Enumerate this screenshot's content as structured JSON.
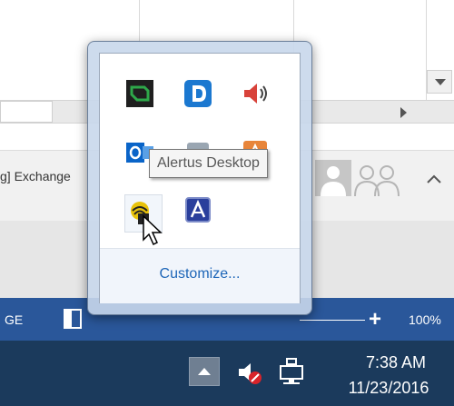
{
  "document": {
    "exchange_label": "g] Exchange"
  },
  "status_bar": {
    "left_text": "GE",
    "zoom_level": "100%",
    "zoom_plus": "+"
  },
  "overflow_popup": {
    "icons": [
      {
        "name": "green-app-icon",
        "color": "#2ea84a"
      },
      {
        "name": "d-app-icon",
        "color": "#1b78d0"
      },
      {
        "name": "volume-icon",
        "color": "#d8423a"
      },
      {
        "name": "outlook-icon",
        "color": "#0a64c8"
      },
      {
        "name": "gray-app-icon",
        "color": "#9aa6b2"
      },
      {
        "name": "orange-app-icon",
        "color": "#e8853a"
      },
      {
        "name": "alertus-icon",
        "color": "#e8c20a"
      },
      {
        "name": "a-app-icon",
        "color": "#2a3f9c"
      }
    ],
    "customize_label": "Customize..."
  },
  "tooltip": {
    "text": "Alertus Desktop"
  },
  "taskbar": {
    "time": "7:38 AM",
    "date": "11/23/2016"
  },
  "colors": {
    "status_bar": "#2a579a",
    "taskbar": "#1b3a5c",
    "link": "#1e66b8"
  }
}
